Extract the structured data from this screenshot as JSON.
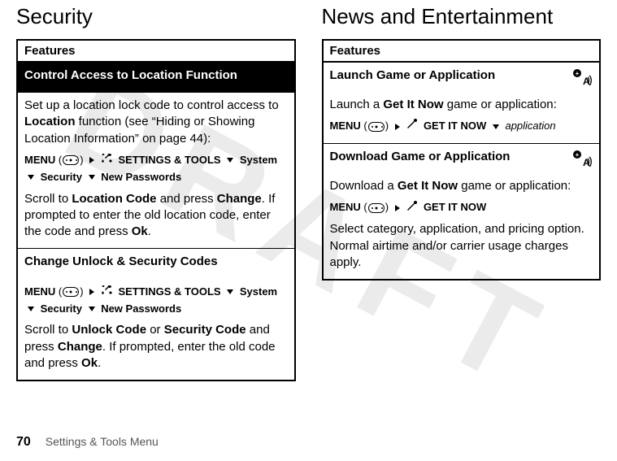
{
  "watermark": "DRAFT",
  "left": {
    "title": "Security",
    "table_header": "Features",
    "row1": {
      "heading": "Control Access to Location Function",
      "body1a": "Set up a location lock code to control access to ",
      "body1b": "Location",
      "body1c": " function (see “Hiding or Showing Location Information” on page 44):",
      "path_menu": "MENU",
      "path_settings": "SETTINGS & TOOLS",
      "path_system": "System",
      "path_security": "Security",
      "path_newpw": "New Passwords",
      "body2a": "Scroll to ",
      "body2b": "Location Code",
      "body2c": " and press ",
      "body2d": "Change",
      "body2e": ". If prompted to enter the old location code, enter the code and press ",
      "body2f": "Ok",
      "body2g": "."
    },
    "row2": {
      "heading": "Change Unlock & Security Codes",
      "path_menu": "MENU",
      "path_settings": "SETTINGS & TOOLS",
      "path_system": "System",
      "path_security": "Security",
      "path_newpw": "New Passwords",
      "body1a": "Scroll to ",
      "body1b": "Unlock Code",
      "body1c": " or ",
      "body1d": "Security Code",
      "body1e": " and press ",
      "body1f": "Change",
      "body1g": ". If prompted, enter the old code and press ",
      "body1h": "Ok",
      "body1i": "."
    }
  },
  "right": {
    "title": "News and Entertainment",
    "table_header": "Features",
    "row1": {
      "heading": "Launch Game or Application",
      "body1a": "Launch a ",
      "body1b": "Get It Now",
      "body1c": " game or application:",
      "path_menu": "MENU",
      "path_getit": "GET IT NOW",
      "path_app": "application"
    },
    "row2": {
      "heading": "Download Game or Application",
      "body1a": "Download a ",
      "body1b": "Get It Now",
      "body1c": " game or application:",
      "path_menu": "MENU",
      "path_getit": "GET IT NOW",
      "body2": "Select category, application, and pricing option. Normal airtime and/or carrier usage charges apply."
    }
  },
  "footer": {
    "page": "70",
    "section": "Settings & Tools Menu"
  }
}
